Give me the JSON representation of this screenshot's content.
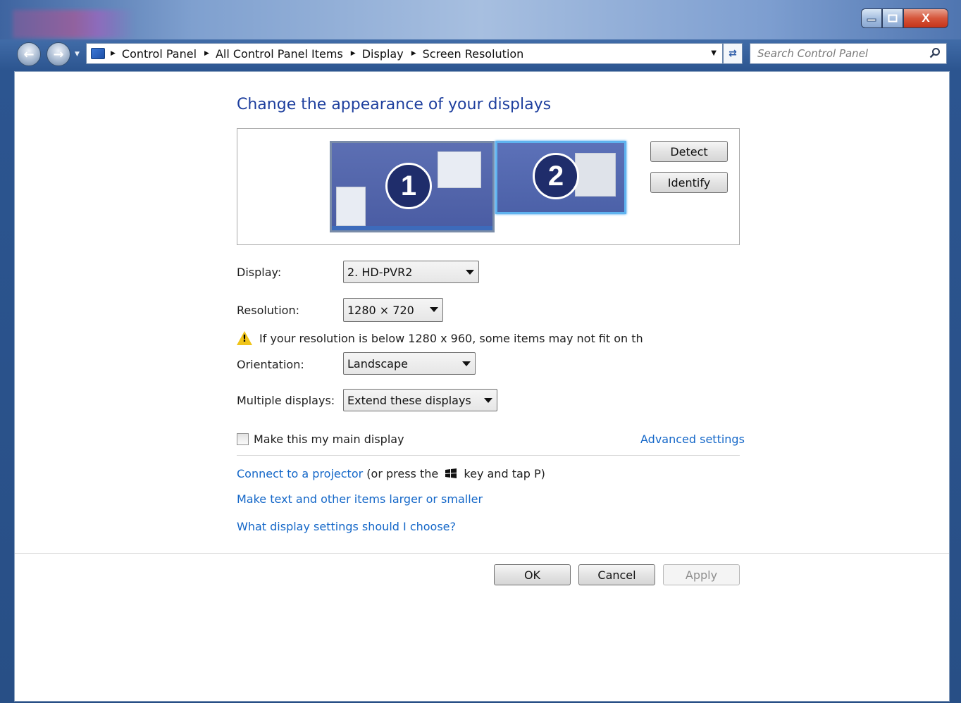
{
  "address_bar": {
    "crumbs": [
      "Control Panel",
      "All Control Panel Items",
      "Display",
      "Screen Resolution"
    ]
  },
  "search": {
    "placeholder": "Search Control Panel"
  },
  "window_controls": {
    "close_label": "X"
  },
  "page": {
    "heading": "Change the appearance of your displays"
  },
  "preview": {
    "monitors": [
      {
        "number": "1",
        "selected": false
      },
      {
        "number": "2",
        "selected": true
      }
    ],
    "detect_label": "Detect",
    "identify_label": "Identify"
  },
  "form": {
    "display_label": "Display:",
    "display_value": "2. HD-PVR2",
    "resolution_label": "Resolution:",
    "resolution_value": "1280 × 720",
    "warning_text": "If your resolution is below 1280 x 960, some items may not fit on th",
    "orientation_label": "Orientation:",
    "orientation_value": "Landscape",
    "multiple_label": "Multiple displays:",
    "multiple_value": "Extend these displays",
    "main_display_label": "Make this my main display",
    "main_display_checked": false,
    "advanced_link": "Advanced settings"
  },
  "links": {
    "projector_link": "Connect to a projector",
    "projector_suffix_a": "(or press the",
    "projector_suffix_b": "key and tap P)",
    "text_size_link": "Make text and other items larger or smaller",
    "settings_help_link": "What display settings should I choose?"
  },
  "footer": {
    "ok_label": "OK",
    "cancel_label": "Cancel",
    "apply_label": "Apply"
  },
  "colors": {
    "heading": "#1e3f9e",
    "link": "#1467c8",
    "monitor_selected_border": "#5fb3ef"
  }
}
